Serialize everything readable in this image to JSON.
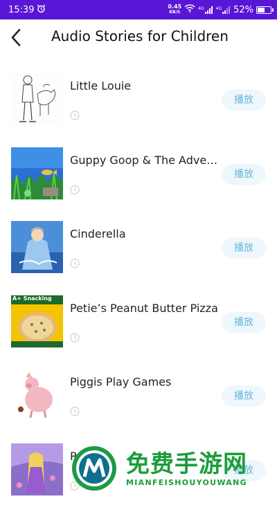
{
  "status_bar": {
    "time": "15:39",
    "net_speed_value": "0.45",
    "net_speed_unit": "KB/S",
    "signal_1": "4G",
    "signal_2": "4G",
    "battery": "52%",
    "battery_level": 0.52
  },
  "header": {
    "title": "Audio Stories for Children"
  },
  "play_label": "播放",
  "stories": [
    {
      "title": "Little Louie",
      "thumb_icon": "boy-and-horse-sketch"
    },
    {
      "title": "Guppy Goop & The Adventu…",
      "thumb_icon": "underwater-scene"
    },
    {
      "title": "Cinderella",
      "thumb_icon": "cinderella-cover"
    },
    {
      "title": "Petie’s Peanut Butter Pizza",
      "thumb_icon": "pizza-cover",
      "thumb_text": "A+ Snacking"
    },
    {
      "title": "Piggis Play Games",
      "thumb_icon": "pink-pig"
    },
    {
      "title": "Ra…el",
      "thumb_icon": "rapunzel-cover"
    }
  ],
  "watermark": {
    "chinese_text": "免费手游网",
    "english_text": "MIANFEISHOUYOUWANG"
  },
  "colors": {
    "status_bar": "#5a16d6",
    "play_button_bg": "#eef7fb",
    "play_button_text": "#6ab5dc",
    "watermark_green": "#1b9d3a"
  }
}
